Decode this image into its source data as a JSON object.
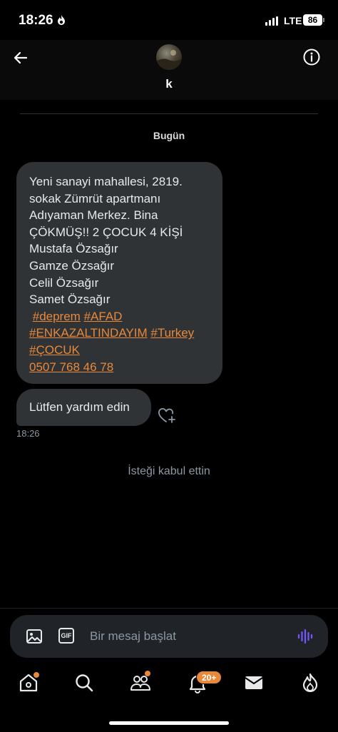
{
  "status_bar": {
    "time": "18:26",
    "network": "LTE",
    "battery": "86"
  },
  "header": {
    "back_icon": "arrow-left-icon",
    "name": "k",
    "info_icon": "info-circle-icon"
  },
  "conversation": {
    "date_label": "Bugün",
    "messages": [
      {
        "lines": [
          "Yeni sanayi mahallesi, 2819.",
          "sokak Zümrüt apartmanı",
          "Adıyaman Merkez. Bina",
          "ÇÖKMÜŞ!! 2 ÇOCUK 4 KİŞİ",
          "Mustafa Özsağır",
          "Gamze Özsağır",
          "Celil Özsağır",
          "Samet Özsağır"
        ],
        "tags": [
          "#deprem",
          "#AFAD",
          "#ENKAZALTINDAYIM",
          "#Turkey",
          "#ÇOCUK"
        ],
        "phone": "0507 768 46 78"
      },
      {
        "text": "Lütfen yardım edin",
        "time": "18:26"
      }
    ],
    "request_note": "İsteği kabul ettin"
  },
  "composer": {
    "placeholder": "Bir mesaj başlat",
    "gif_label": "GIF"
  },
  "bottom_nav": {
    "items": [
      "home-icon",
      "search-icon",
      "communities-icon",
      "notifications-icon",
      "messages-icon",
      "spaces-icon"
    ],
    "notifications_badge": "20+"
  },
  "colors": {
    "background": "#000000",
    "bubble": "#2f3336",
    "accent": "#e8883a",
    "muted_text": "#8b98a5",
    "voice_accent": "#7856ff"
  }
}
